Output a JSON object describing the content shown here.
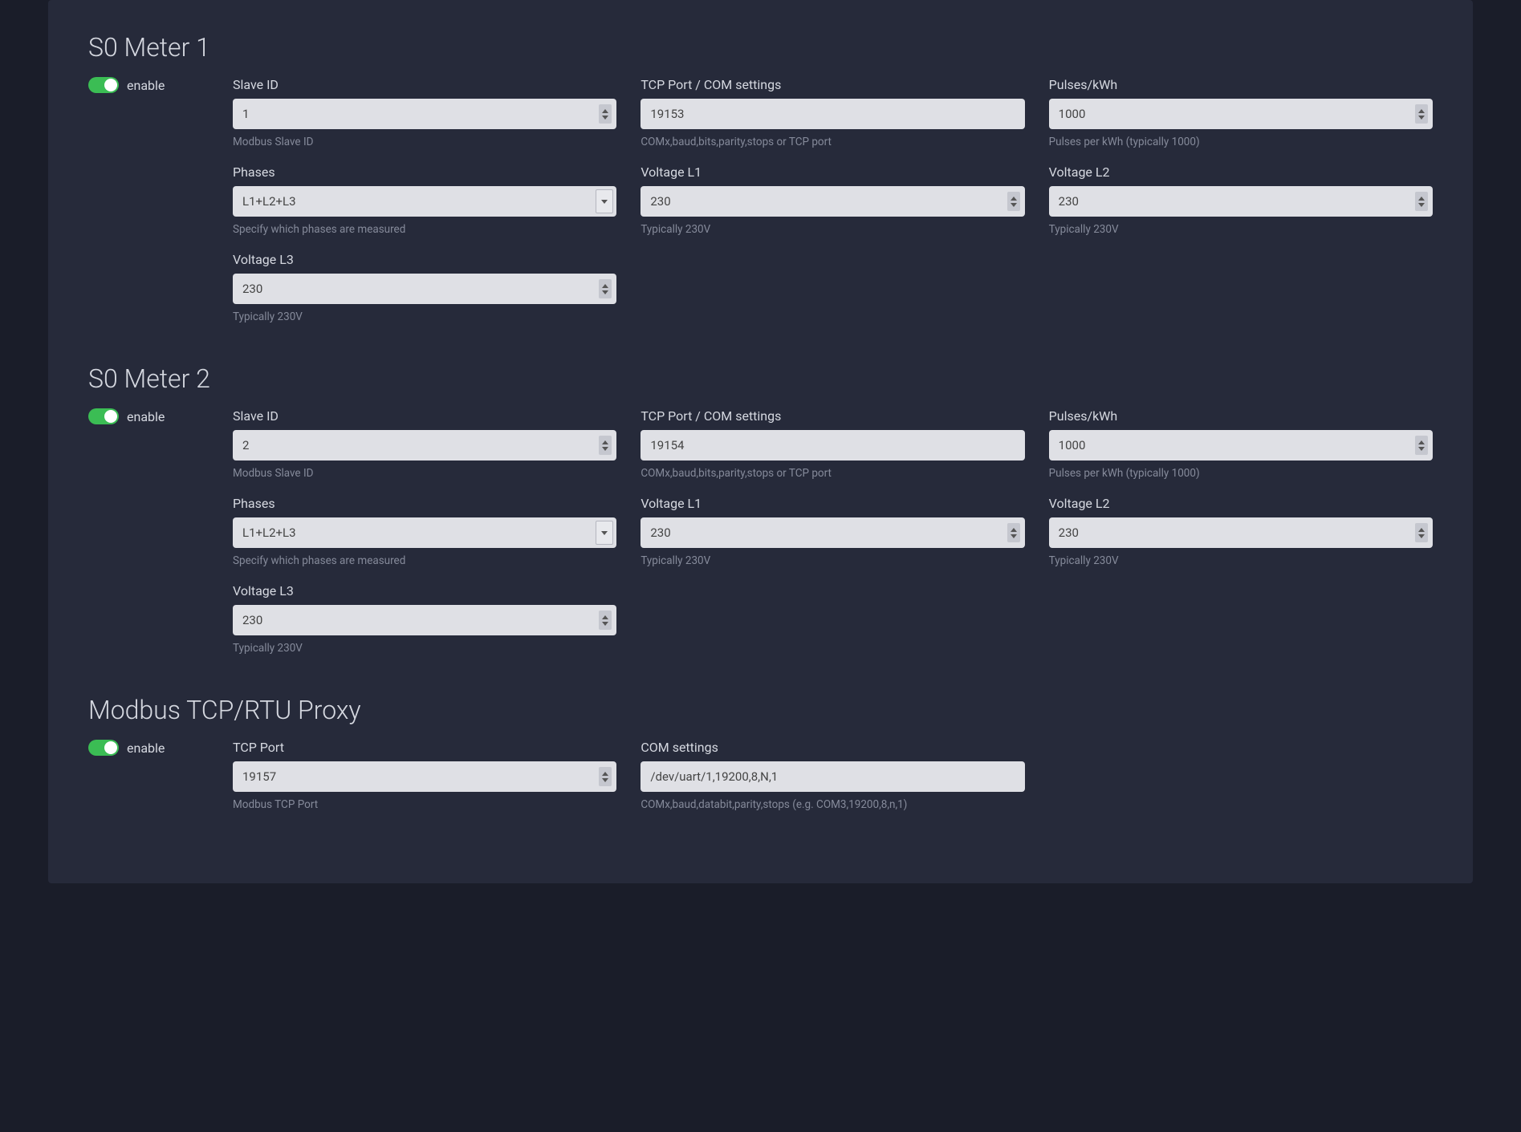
{
  "sections": [
    {
      "title": "S0 Meter 1",
      "enable_label": "enable",
      "rows": [
        [
          {
            "label": "Slave ID",
            "value": "1",
            "help": "Modbus Slave ID",
            "type": "number"
          },
          {
            "label": "TCP Port / COM settings",
            "value": "19153",
            "help": "COMx,baud,bits,parity,stops or TCP port",
            "type": "text"
          },
          {
            "label": "Pulses/kWh",
            "value": "1000",
            "help": "Pulses per kWh (typically 1000)",
            "type": "number"
          }
        ],
        [
          {
            "label": "Phases",
            "value": "L1+L2+L3",
            "help": "Specify which phases are measured",
            "type": "select"
          },
          {
            "label": "Voltage L1",
            "value": "230",
            "help": "Typically 230V",
            "type": "number"
          },
          {
            "label": "Voltage L2",
            "value": "230",
            "help": "Typically 230V",
            "type": "number"
          }
        ],
        [
          {
            "label": "Voltage L3",
            "value": "230",
            "help": "Typically 230V",
            "type": "number"
          }
        ]
      ]
    },
    {
      "title": "S0 Meter 2",
      "enable_label": "enable",
      "rows": [
        [
          {
            "label": "Slave ID",
            "value": "2",
            "help": "Modbus Slave ID",
            "type": "number"
          },
          {
            "label": "TCP Port / COM settings",
            "value": "19154",
            "help": "COMx,baud,bits,parity,stops or TCP port",
            "type": "text"
          },
          {
            "label": "Pulses/kWh",
            "value": "1000",
            "help": "Pulses per kWh (typically 1000)",
            "type": "number"
          }
        ],
        [
          {
            "label": "Phases",
            "value": "L1+L2+L3",
            "help": "Specify which phases are measured",
            "type": "select"
          },
          {
            "label": "Voltage L1",
            "value": "230",
            "help": "Typically 230V",
            "type": "number"
          },
          {
            "label": "Voltage L2",
            "value": "230",
            "help": "Typically 230V",
            "type": "number"
          }
        ],
        [
          {
            "label": "Voltage L3",
            "value": "230",
            "help": "Typically 230V",
            "type": "number"
          }
        ]
      ]
    },
    {
      "title": "Modbus TCP/RTU Proxy",
      "enable_label": "enable",
      "rows": [
        [
          {
            "label": "TCP Port",
            "value": "19157",
            "help": "Modbus TCP Port",
            "type": "number"
          },
          {
            "label": "COM settings",
            "value": "/dev/uart/1,19200,8,N,1",
            "help": "COMx,baud,databit,parity,stops (e.g. COM3,19200,8,n,1)",
            "type": "text"
          }
        ]
      ]
    }
  ]
}
